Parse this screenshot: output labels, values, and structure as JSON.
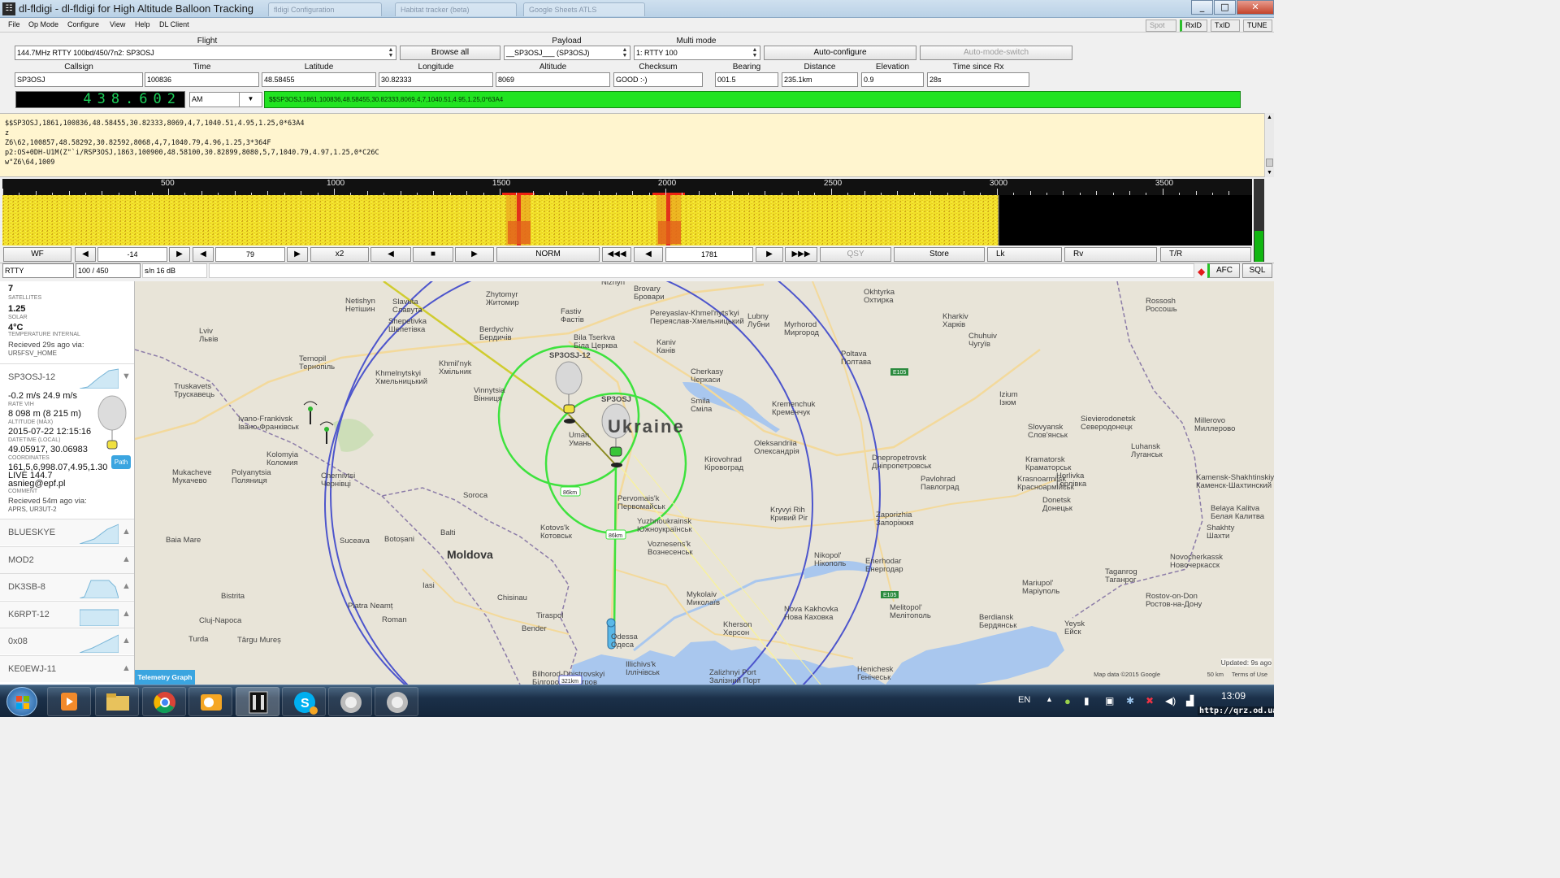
{
  "window": {
    "title": "dl-fldigi - dl-fldigi for High Altitude Balloon Tracking",
    "bg_tabs": [
      "fldigi Configuration",
      "Habitat tracker (beta)",
      "Google Sheets ATLS"
    ],
    "min": "_",
    "max": "□",
    "close": "✕"
  },
  "menu": {
    "items": [
      "File",
      "Op Mode",
      "Configure",
      "View",
      "Help",
      "DL Client"
    ],
    "right_buttons": [
      "Spot",
      "RxID",
      "TxID",
      "TUNE"
    ]
  },
  "flight": {
    "flight_label": "Flight",
    "flight_value": "144.7MHz RTTY 100bd/450/7n2: SP3OSJ",
    "browse_all": "Browse all",
    "payload_label": "Payload",
    "payload_value": "__SP3OSJ___ (SP3OSJ)",
    "multimode_label": "Multi mode",
    "multimode_value": "1: RTTY 100",
    "autoconfig": "Auto-configure",
    "automodeswitch": "Auto-mode-switch"
  },
  "telemetry": {
    "callsign_label": "Callsign",
    "callsign": "SP3OSJ",
    "time_label": "Time",
    "time": "100836",
    "lat_label": "Latitude",
    "lat": "48.58455",
    "lon_label": "Longitude",
    "lon": "30.82333",
    "alt_label": "Altitude",
    "alt": "8069",
    "checksum_label": "Checksum",
    "checksum": "GOOD :-)",
    "bearing_label": "Bearing",
    "bearing": "001.5",
    "distance_label": "Distance",
    "distance": "235.1km",
    "elevation_label": "Elevation",
    "elevation": "0.9",
    "since_label": "Time since Rx",
    "since": "28s"
  },
  "radio": {
    "freq": "438.602",
    "mode": "AM",
    "rx_line": "$$SP3OSJ,1861,100836,48.58455,30.82333,8069,4,7,1040.51,4.95,1.25,0*63A4"
  },
  "rx_text": [
    "$$SP3OSJ,1861,100836,48.58455,30.82333,8069,4,7,1040.51,4.95,1.25,0*63A4",
    "z",
    "Z6\\62,100857,48.58292,30.82592,8068,4,7,1040.79,4.96,1.25,3*364F",
    "p2:OS+0DH-U1M(Z\"`i/RSP3OSJ,1863,100900,48.58100,30.82899,8080,5,7,1040.79,4.97,1.25,0*C26C",
    "w\"Z6\\64,1009"
  ],
  "waterfall": {
    "scale": [
      "500",
      "1000",
      "1500",
      "2000",
      "2500",
      "3000",
      "3500"
    ]
  },
  "controls": {
    "wf": "WF",
    "prev": "◀",
    "next": "▶",
    "offset": "-14",
    "val2": "79",
    "x2": "x2",
    "norm": "NORM",
    "rew": "◀◀◀",
    "center": "1781",
    "ffw": "▶▶▶",
    "qsy": "QSY",
    "store": "Store",
    "lk": "Lk",
    "rv": "Rv",
    "tr": "T/R"
  },
  "status": {
    "mode": "RTTY",
    "bw": "100 / 450",
    "sn": "s/n  16 dB",
    "afc": "AFC",
    "sql": "SQL"
  },
  "panel": {
    "top_value": "7",
    "top_label": "SATELLITES",
    "solar_val": "1.25",
    "solar_lbl": "SOLAR",
    "temp_val": "4°C",
    "temp_lbl": "TEMPERATURE INTERNAL",
    "recv1": "Recieved 29s ago via:",
    "recv1b": "UR5FSV_HOME",
    "callsign": "SP3OSJ-12",
    "rate_val": "-0.2 m/s 24.9 m/s",
    "rate_lbl": "RATE VIH",
    "alt_val": "8 098 m (8 215 m)",
    "alt_lbl": "ALTITUDE (MAX)",
    "dt_val": "2015-07-22 12:15:16",
    "dt_lbl": "DATETIME (LOCAL)",
    "coord_val": "49.05917, 30.06983",
    "coord_lbl": "COORDINATES",
    "comment1": "161,5,6,998.07,4.95,1.30",
    "comment2": "LIVE 144.7",
    "comment3": "asnieg@epf.pl",
    "comment_lbl": "COMMENT",
    "recv2": "Recieved 54m ago via:",
    "recv2b": "APRS, UR3UT-2",
    "path_btn": "Path",
    "list": [
      "BLUESKYE",
      "MOD2",
      "DK3SB-8",
      "K6RPT-12",
      "0x08",
      "KE0EWJ-11"
    ],
    "tele_btn": "Telemetry Graph"
  },
  "map": {
    "balloon1": "SP3OSJ-12",
    "balloon2": "SP3OSJ",
    "country": "Ukraine",
    "moldova": "Moldova",
    "r1": "86km",
    "r2": "86km",
    "r3": "321km",
    "attribution": "Map data ©2015 Google",
    "scale": "50 km",
    "terms": "Terms of Use",
    "updated": "Updated: 9s ago",
    "cities": [
      [
        "Netishyn",
        "Нетішин",
        425,
        373
      ],
      [
        "Slavuta",
        "Славута",
        483,
        374
      ],
      [
        "Zhytomyr",
        "Житомир",
        598,
        365
      ],
      [
        "Brovary",
        "Бровари",
        780,
        358
      ],
      [
        "Nizhyn",
        "",
        740,
        350
      ],
      [
        "Okhtyrka",
        "Охтирка",
        1063,
        362
      ],
      [
        "Lviv",
        "Львів",
        245,
        410
      ],
      [
        "Shepetivka",
        "Шепетівка",
        478,
        398
      ],
      [
        "Berdychiv",
        "Бердичів",
        590,
        408
      ],
      [
        "Fastiv",
        "Фастів",
        690,
        386
      ],
      [
        "Pereyaslav-Khmel'nyts'kyi",
        "Переяслав-Хмельницький",
        800,
        388
      ],
      [
        "Lubny",
        "Лубни",
        920,
        392
      ],
      [
        "Myrhorod",
        "Миргород",
        965,
        402
      ],
      [
        "Kharkiv",
        "Харків",
        1160,
        392
      ],
      [
        "Rossosh",
        "Россошь",
        1410,
        373
      ],
      [
        "Ternopil",
        "Тернопіль",
        368,
        444
      ],
      [
        "Khmelnytskyi",
        "Хмельницький",
        462,
        462
      ],
      [
        "Bila Tserkva",
        "Біла Церква",
        706,
        418
      ],
      [
        "Kaniv",
        "Канів",
        808,
        424
      ],
      [
        "Poltava",
        "Полтава",
        1035,
        438
      ],
      [
        "Chuhuiv",
        "Чугуїв",
        1192,
        416
      ],
      [
        "Khmil'nyk",
        "Хмільник",
        540,
        450
      ],
      [
        "Vinnytsia",
        "Вінниця",
        583,
        483
      ],
      [
        "Cherkasy",
        "Черкаси",
        850,
        460
      ],
      [
        "Smila",
        "Сміла",
        850,
        496
      ],
      [
        "Kremenchuk",
        "Кременчук",
        950,
        500
      ],
      [
        "Truskavets",
        "Трускавець",
        214,
        478
      ],
      [
        "Ivano-Frankivsk",
        "Івано-Франківськ",
        293,
        518
      ],
      [
        "Izium",
        "Ізюм",
        1230,
        488
      ],
      [
        "Sievierodonetsk",
        "Северодонецк",
        1330,
        518
      ],
      [
        "Slovyansk",
        "Слов'янськ",
        1265,
        528
      ],
      [
        "Millerovo",
        "Миллерово",
        1470,
        520
      ],
      [
        "Kolomyia",
        "Коломия",
        328,
        562
      ],
      [
        "Uman",
        "Умань",
        700,
        538
      ],
      [
        "Oleksandriia",
        "Олександрія",
        928,
        548
      ],
      [
        "Kirovohrad",
        "Кіровоград",
        867,
        568
      ],
      [
        "Dnepropetrovsk",
        "Дніпропетровськ",
        1073,
        566
      ],
      [
        "Kramatorsk",
        "Краматорськ",
        1262,
        568
      ],
      [
        "Luhansk",
        "Луганськ",
        1392,
        552
      ],
      [
        "Chernivtsi",
        "Чернівці",
        395,
        588
      ],
      [
        "Mukacheve",
        "Мукачево",
        212,
        584
      ],
      [
        "Polyanytsia",
        "Поляниця",
        285,
        584
      ],
      [
        "Horlivka",
        "Горлівка",
        1300,
        588
      ],
      [
        "Krasnoarmiisk",
        "Красноармійськ",
        1252,
        592
      ],
      [
        "Pavlohrad",
        "Павлоград",
        1133,
        592
      ],
      [
        "Kamensk-Shakhtinskiy",
        "Каменск-Шахтинский",
        1472,
        590
      ],
      [
        "Soroca",
        "",
        570,
        612
      ],
      [
        "Pervomais'k",
        "Первомайськ",
        760,
        616
      ],
      [
        "Donetsk",
        "Донецьк",
        1283,
        618
      ],
      [
        "Belaya Kalitva",
        "Белая Калитва",
        1490,
        628
      ],
      [
        "Kryvyi Rih",
        "Кривий Ріг",
        948,
        630
      ],
      [
        "Zaporizhia",
        "Запоріжжя",
        1078,
        636
      ],
      [
        "Yuzhnoukrainsk",
        "Южноукраїнськ",
        784,
        644
      ],
      [
        "Kotovs'k",
        "Котовськ",
        665,
        652
      ],
      [
        "Balti",
        "",
        542,
        658
      ],
      [
        "Shakhty",
        "Шахти",
        1485,
        652
      ],
      [
        "Baia Mare",
        "",
        204,
        667
      ],
      [
        "Botoșani",
        "",
        473,
        666
      ],
      [
        "Suceava",
        "",
        418,
        668
      ],
      [
        "Voznesens'k",
        "Вознесенськ",
        797,
        672
      ],
      [
        "Nikopol'",
        "Нікополь",
        1002,
        686
      ],
      [
        "Enerhodar",
        "Енергодар",
        1065,
        693
      ],
      [
        "Novocherkassk",
        "Новочеркасск",
        1440,
        688
      ],
      [
        "Bistrita",
        "",
        272,
        736
      ],
      [
        "Iasi",
        "",
        520,
        723
      ],
      [
        "Mykolaiv",
        "Миколаїв",
        845,
        734
      ],
      [
        "Taganrog",
        "Таганрог",
        1360,
        706
      ],
      [
        "Mariupol'",
        "Маріуполь",
        1258,
        720
      ],
      [
        "Chisinau",
        "",
        612,
        738
      ],
      [
        "Piatra Neamț",
        "",
        428,
        748
      ],
      [
        "Melitopol'",
        "Мелітополь",
        1095,
        750
      ],
      [
        "Rostov-on-Don",
        "Ростов-на-Дону",
        1410,
        736
      ],
      [
        "Cluj-Napoca",
        "",
        245,
        766
      ],
      [
        "Roman",
        "",
        470,
        765
      ],
      [
        "Tiraspol",
        "",
        660,
        760
      ],
      [
        "Nova Kakhovka",
        "Нова Каховка",
        965,
        752
      ],
      [
        "Kherson",
        "Херсон",
        890,
        771
      ],
      [
        "Berdiansk",
        "Бердянськ",
        1205,
        762
      ],
      [
        "Yeysk",
        "Ейск",
        1310,
        770
      ],
      [
        "Bender",
        "",
        642,
        776
      ],
      [
        "Turda",
        "",
        232,
        789
      ],
      [
        "Târgu Mureș",
        "",
        292,
        790
      ],
      [
        "Odessa",
        "Одеса",
        752,
        786
      ],
      [
        "Illichivs'k",
        "Іллічівськ",
        770,
        820
      ],
      [
        "Zalizhnyi Port",
        "Залізний Порт",
        873,
        830
      ],
      [
        "Henichesk",
        "Генічеськ",
        1055,
        826
      ],
      [
        "Bilhorod-Dnistrovskyi",
        "Білгород-Дністров",
        655,
        832
      ]
    ]
  },
  "taskbar": {
    "lang": "EN",
    "time": "13:09",
    "watermark": "http://qrz.od.ua"
  }
}
